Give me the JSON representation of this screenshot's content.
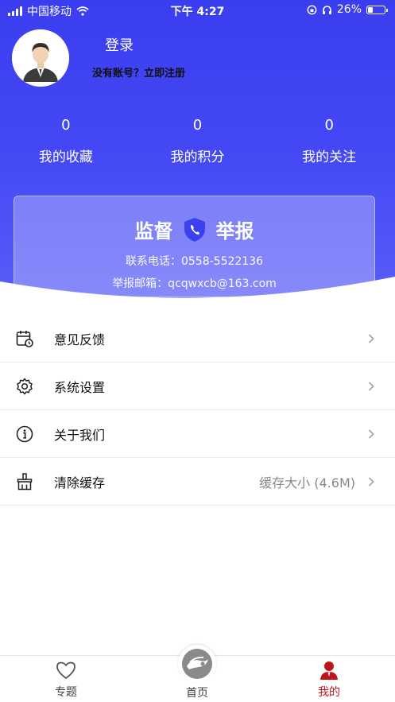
{
  "status_bar": {
    "carrier": "中国移动",
    "time": "下午 4:27",
    "battery_percent": "26%",
    "battery_level": 0.26
  },
  "profile": {
    "login_label": "登录",
    "no_account_text": "没有账号？",
    "register_link": "立即注册"
  },
  "stats": [
    {
      "value": "0",
      "label": "我的收藏"
    },
    {
      "value": "0",
      "label": "我的积分"
    },
    {
      "value": "0",
      "label": "我的关注"
    }
  ],
  "report_card": {
    "title_left": "监督",
    "title_right": "举报",
    "phone_line": "联系电话：0558-5522136",
    "email_line": "举报邮箱：qcqwxcb@163.com"
  },
  "menu": {
    "items": [
      {
        "label": "意见反馈",
        "icon": "calendar-clock-icon"
      },
      {
        "label": "系统设置",
        "icon": "gear-icon"
      },
      {
        "label": "关于我们",
        "icon": "info-icon"
      },
      {
        "label": "清除缓存",
        "icon": "broom-icon",
        "value": "缓存大小 (4.6M)"
      }
    ]
  },
  "tab_bar": {
    "tabs": [
      {
        "label": "专题",
        "icon": "heart-icon"
      },
      {
        "label": "首页",
        "icon": "home-logo-icon"
      },
      {
        "label": "我的",
        "icon": "person-icon"
      }
    ],
    "active_color": "#c0141b"
  },
  "colors": {
    "header_blue": "#3a3ef0",
    "accent_red": "#c0141b"
  }
}
